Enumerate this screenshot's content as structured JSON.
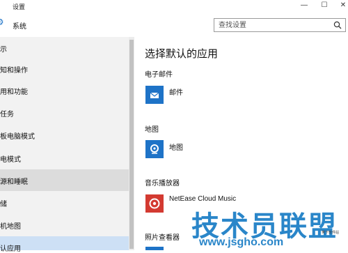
{
  "window": {
    "title": "设置",
    "controls": {
      "minimize": "—",
      "maximize": "☐",
      "close": "✕"
    }
  },
  "header": {
    "section_title": "系统",
    "search": {
      "placeholder": "查找设置"
    }
  },
  "sidebar": {
    "items": [
      {
        "label": "示"
      },
      {
        "label": "知和操作"
      },
      {
        "label": "用和功能"
      },
      {
        "label": "任务"
      },
      {
        "label": "板电脑模式"
      },
      {
        "label": "电模式"
      },
      {
        "label": "源和睡眠"
      },
      {
        "label": "储"
      },
      {
        "label": "机地图"
      },
      {
        "label": "认应用"
      }
    ]
  },
  "main": {
    "title": "选择默认的应用",
    "groups": [
      {
        "label": "电子邮件",
        "app": "邮件",
        "icon": "mail-icon",
        "color": "#1e73c7"
      },
      {
        "label": "地图",
        "app": "地图",
        "icon": "maps-icon",
        "color": "#1e73c7"
      },
      {
        "label": "音乐播放器",
        "app": "NetEase Cloud Music",
        "icon": "netease-icon",
        "color": "#d33a31"
      },
      {
        "label": "照片查看器",
        "app": "",
        "icon": "photos-icon",
        "color": "#1e73c7"
      }
    ]
  },
  "watermark": {
    "brand": "技术员联盟",
    "url": "www.jsgho.com",
    "tagline": "笑下软件站"
  },
  "colors": {
    "accent": "#1e73c7",
    "sidebar_bg": "#f2f2f2",
    "selected_bg": "#cde0f5"
  }
}
